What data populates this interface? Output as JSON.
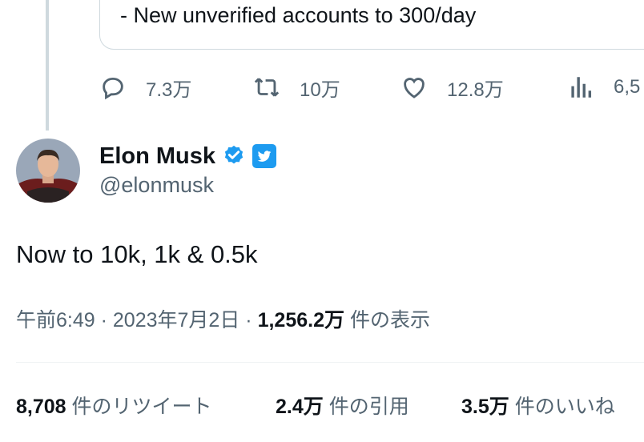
{
  "quoted_tweet": {
    "text": "- New unverified accounts to 300/day"
  },
  "actions": {
    "reply_count": "7.3万",
    "retweet_count": "10万",
    "like_count": "12.8万",
    "views_count": "6,5"
  },
  "author": {
    "display_name": "Elon Musk",
    "handle": "@elonmusk",
    "verified_icon": "verified-badge-icon",
    "affiliate_icon": "twitter-bird-icon"
  },
  "tweet": {
    "text": "Now to 10k, 1k & 0.5k",
    "time": "午前6:49",
    "separator": "·",
    "date": "2023年7月2日",
    "views_number": "1,256.2万",
    "views_label": "件の表示"
  },
  "stats": {
    "retweets_number": "8,708",
    "retweets_label": "件のリツイート",
    "quotes_number": "2.4万",
    "quotes_label": "件の引用",
    "likes_number": "3.5万",
    "likes_label": "件のいいね"
  },
  "colors": {
    "accent": "#1d9bf0",
    "secondary_text": "#536471",
    "border": "#cfd9de"
  }
}
